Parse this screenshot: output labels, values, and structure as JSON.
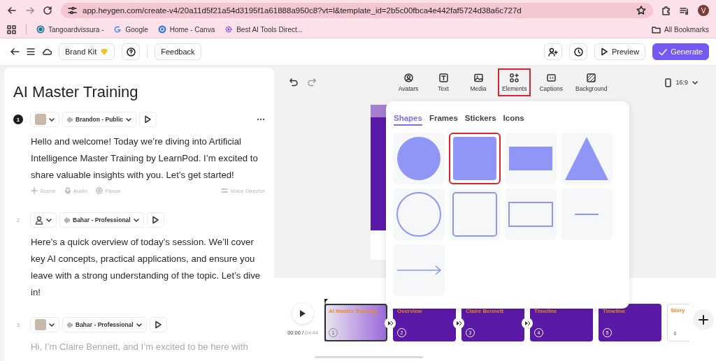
{
  "browser": {
    "url": "app.heygen.com/create-v4/20a11d5f21a54d3195f1a61888a950c8?vt=l&template_id=2b5c00fbca4e442faf5724d38a6c727d",
    "profile_initial": "V"
  },
  "bookmarks": [
    {
      "label": "Tangoardvissura -",
      "kind": "wordpress"
    },
    {
      "label": "Google",
      "kind": "google"
    },
    {
      "label": "Home - Canva",
      "kind": "canva"
    },
    {
      "label": "Best AI Tools Direct...",
      "kind": "gear"
    }
  ],
  "all_bookmarks": "All Bookmarks",
  "header": {
    "brand_kit": "Brand Kit",
    "feedback": "Feedback",
    "preview": "Preview",
    "generate": "Generate"
  },
  "script": {
    "title": "AI Master Training",
    "scenes": [
      {
        "number": "1",
        "active": true,
        "avatar": {
          "kind": "photo"
        },
        "voice": "Brandon - Public",
        "dimmed": false,
        "text": "Hello and welcome! Today we’re diving into Artificial Intelligence Master Training by LearnPod. I’m excited to share valuable insights with you. Let’s get started!",
        "actions": [
          "Scene",
          "Audio",
          "Pause"
        ],
        "voice_director": "Voice Director"
      },
      {
        "number": "2",
        "active": false,
        "avatar": {
          "kind": "silhouette"
        },
        "voice": "Bahar - Professional",
        "dimmed": false,
        "text": "Here’s a quick overview of today’s session. We’ll cover key AI concepts, practical applications, and ensure you leave with a strong understanding of the topic. Let’s dive in!"
      },
      {
        "number": "3",
        "active": false,
        "avatar": {
          "kind": "photo"
        },
        "voice": "Bahar - Professional",
        "dimmed": true,
        "text": "Hi, I’m Claire Bennett, and I’m excited to be here with"
      }
    ]
  },
  "tools": [
    {
      "label": "Avatars",
      "kind": "avatar",
      "selected": false
    },
    {
      "label": "Text",
      "kind": "text",
      "selected": false
    },
    {
      "label": "Media",
      "kind": "media",
      "selected": false
    },
    {
      "label": "Elements",
      "kind": "elements",
      "selected": true
    },
    {
      "label": "Captions",
      "kind": "captions",
      "selected": false
    },
    {
      "label": "Background",
      "kind": "background",
      "selected": false
    }
  ],
  "aspect_ratio": "16:9",
  "elements_panel": {
    "tabs": [
      {
        "label": "Shapes",
        "selected": true
      },
      {
        "label": "Frames",
        "selected": false
      },
      {
        "label": "Stickers",
        "selected": false
      },
      {
        "label": "Icons",
        "selected": false
      }
    ],
    "shapes": [
      {
        "kind": "circle",
        "filled": true,
        "selected": false
      },
      {
        "kind": "square",
        "filled": true,
        "selected": true
      },
      {
        "kind": "rectangle",
        "filled": true,
        "selected": false
      },
      {
        "kind": "triangle",
        "filled": true,
        "selected": false
      },
      {
        "kind": "circle",
        "filled": false,
        "selected": false
      },
      {
        "kind": "square",
        "filled": false,
        "selected": false
      },
      {
        "kind": "rectangle",
        "filled": false,
        "selected": false
      },
      {
        "kind": "line",
        "selected": false
      },
      {
        "kind": "arrow",
        "selected": false
      }
    ]
  },
  "timeline": {
    "time": "00:00",
    "separator": "/",
    "duration": "04:44",
    "clips": [
      {
        "number": "1",
        "title": "AI Master Training",
        "kind": "photo",
        "selected": true,
        "transition": true
      },
      {
        "number": "2",
        "title": "Overview",
        "kind": "purple",
        "selected": false,
        "transition": true
      },
      {
        "number": "3",
        "title": "Claire Bennett",
        "kind": "purple",
        "selected": false,
        "transition": true
      },
      {
        "number": "4",
        "title": "Timeline",
        "kind": "purple",
        "selected": false,
        "transition": false
      },
      {
        "number": "5",
        "title": "Timeline",
        "kind": "purple",
        "selected": false,
        "transition": false
      },
      {
        "number": "6",
        "title": "Story",
        "kind": "white",
        "selected": false,
        "transition": false
      }
    ]
  }
}
